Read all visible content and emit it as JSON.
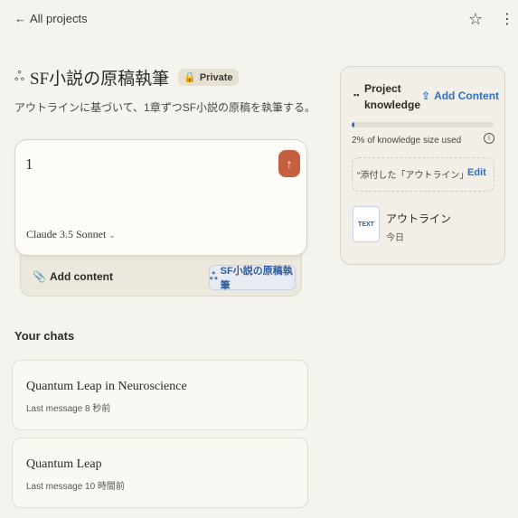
{
  "nav": {
    "back_arrow": "←",
    "back_label": "All projects",
    "star_icon": "☆",
    "more_icon": "⋮"
  },
  "project": {
    "icon": "ஃ",
    "title": "SF小説の原稿執筆",
    "badge_icon": "🔒",
    "badge": "Private",
    "description": "アウトラインに基づいて、1章ずつSF小説の原稿を執筆する。"
  },
  "composer": {
    "input_value": "1",
    "send_icon": "↑",
    "model": "Claude 3.5 Sonnet",
    "model_chevron": "⌄",
    "add_content_icon": "📎",
    "add_content": "Add content",
    "project_chip_icon": "ஃ",
    "project_chip": "SF小説の原稿執筆"
  },
  "chats": {
    "heading": "Your chats",
    "items": [
      {
        "title": "Quantum Leap in Neuroscience",
        "subtitle": "Last message 8 秒前"
      },
      {
        "title": "Quantum Leap",
        "subtitle": "Last message 10 時間前"
      }
    ]
  },
  "knowledge": {
    "icon": "▪▪",
    "title": "Project knowledge",
    "add_icon": "⇪",
    "add_label": "Add Content",
    "usage_fraction": 0.02,
    "usage_text": "2% of knowledge size used",
    "info_icon": "i",
    "instructions_quote": "“",
    "instructions_preview": "添付した「アウトライン」に基づき...",
    "edit_label": "Edit",
    "file_badge": "TEXT",
    "file_name": "アウトライン",
    "file_date": "今日"
  },
  "colors": {
    "accent_send": "#c4603d",
    "link_blue": "#2f6fc0",
    "background": "#f5f3ee"
  }
}
